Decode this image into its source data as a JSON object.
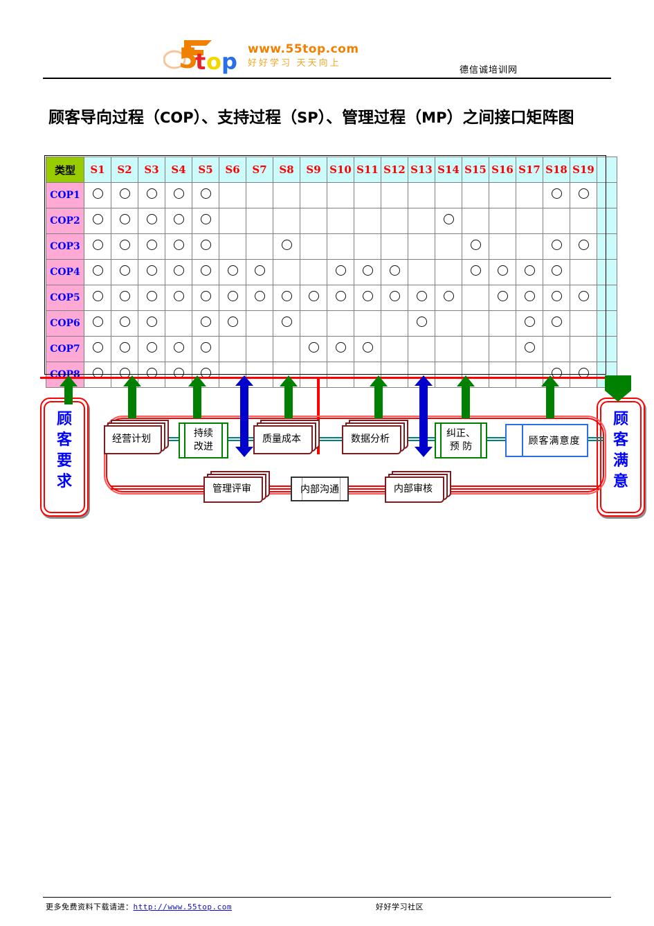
{
  "header": {
    "logo_text": "5top",
    "logo_url": "www.55top.com",
    "logo_slogan": "好好学习  天天向上",
    "site_name": "德信诚培训网"
  },
  "title": {
    "part1": "顾客导向过程（",
    "cop": "COP",
    "part2": "）、支持过程（",
    "sp": "SP",
    "part3": "）、管理过程（",
    "mp": "MP",
    "part4": "）之间接口矩阵图"
  },
  "matrix": {
    "corner_label": "类型",
    "columns": [
      "S1",
      "S2",
      "S3",
      "S4",
      "S5",
      "S6",
      "S7",
      "S8",
      "S9",
      "S10",
      "S11",
      "S12",
      "S13",
      "S14",
      "S15",
      "S16",
      "S17",
      "S18",
      "S19"
    ],
    "rows": [
      {
        "label": "COP1",
        "marks": [
          1,
          1,
          1,
          1,
          1,
          0,
          0,
          0,
          0,
          0,
          0,
          0,
          0,
          0,
          0,
          0,
          0,
          1,
          1
        ]
      },
      {
        "label": "COP2",
        "marks": [
          1,
          1,
          1,
          1,
          1,
          0,
          0,
          0,
          0,
          0,
          0,
          0,
          0,
          1,
          0,
          0,
          0,
          0,
          0
        ]
      },
      {
        "label": "COP3",
        "marks": [
          1,
          1,
          1,
          1,
          1,
          0,
          0,
          1,
          0,
          0,
          0,
          0,
          0,
          0,
          1,
          0,
          0,
          1,
          1
        ]
      },
      {
        "label": "COP4",
        "marks": [
          1,
          1,
          1,
          1,
          1,
          1,
          1,
          0,
          0,
          1,
          1,
          1,
          0,
          0,
          1,
          1,
          1,
          1,
          0
        ]
      },
      {
        "label": "COP5",
        "marks": [
          1,
          1,
          1,
          1,
          1,
          1,
          1,
          1,
          1,
          1,
          1,
          1,
          1,
          1,
          0,
          1,
          1,
          1,
          1
        ]
      },
      {
        "label": "COP6",
        "marks": [
          1,
          1,
          1,
          0,
          1,
          1,
          0,
          1,
          0,
          0,
          0,
          0,
          1,
          0,
          0,
          0,
          1,
          1,
          0
        ]
      },
      {
        "label": "COP7",
        "marks": [
          1,
          1,
          1,
          1,
          1,
          0,
          0,
          0,
          1,
          1,
          1,
          0,
          0,
          0,
          0,
          0,
          1,
          0,
          0
        ]
      },
      {
        "label": "COP8",
        "marks": [
          1,
          1,
          1,
          1,
          1,
          0,
          0,
          0,
          0,
          0,
          0,
          0,
          0,
          0,
          0,
          0,
          0,
          1,
          1
        ]
      }
    ],
    "mark_symbol": "O"
  },
  "diagram": {
    "input_block": [
      "顾",
      "客",
      "要",
      "求"
    ],
    "output_block": [
      "顾",
      "客",
      "满",
      "意"
    ],
    "nodes": [
      {
        "id": "doc-business-plan",
        "label": "经营计划",
        "style": "document"
      },
      {
        "id": "box-continual-improvement",
        "label": "持续 改进",
        "line1": "持续",
        "line2": "改进",
        "style": "green-process"
      },
      {
        "id": "doc-quality-cost",
        "label": "质量成本",
        "style": "document"
      },
      {
        "id": "doc-data-analysis",
        "label": "数据分析",
        "style": "document"
      },
      {
        "id": "box-corrective-preventive",
        "label": "纠正、预 防",
        "line1": "纠正、",
        "line2": "预  防",
        "style": "green-process"
      },
      {
        "id": "box-customer-satisfaction",
        "label": "顾客满意度",
        "style": "blue-process"
      },
      {
        "id": "doc-management-review",
        "label": "管理评审",
        "style": "document"
      },
      {
        "id": "box-internal-communication",
        "label": "内部沟通",
        "style": "gray-process"
      },
      {
        "id": "doc-internal-audit",
        "label": "内部审核",
        "style": "document"
      }
    ]
  },
  "footer": {
    "left_prefix": "更多免费资料下载请进：",
    "left_link": "http://www.55top.com",
    "right": "好好学习社区"
  },
  "colors": {
    "header_cyan": "#ccfbfb",
    "corner_green": "#99cc00",
    "row_pink": "#ffaad5",
    "col_header_text": "#ff0000",
    "row_label_text": "#0000ff",
    "red_rule": "#ff0000",
    "arrow_green": "#008000",
    "arrow_blue": "#0000cd",
    "doc_border": "#7b1c20",
    "teal_line": "#008080"
  }
}
